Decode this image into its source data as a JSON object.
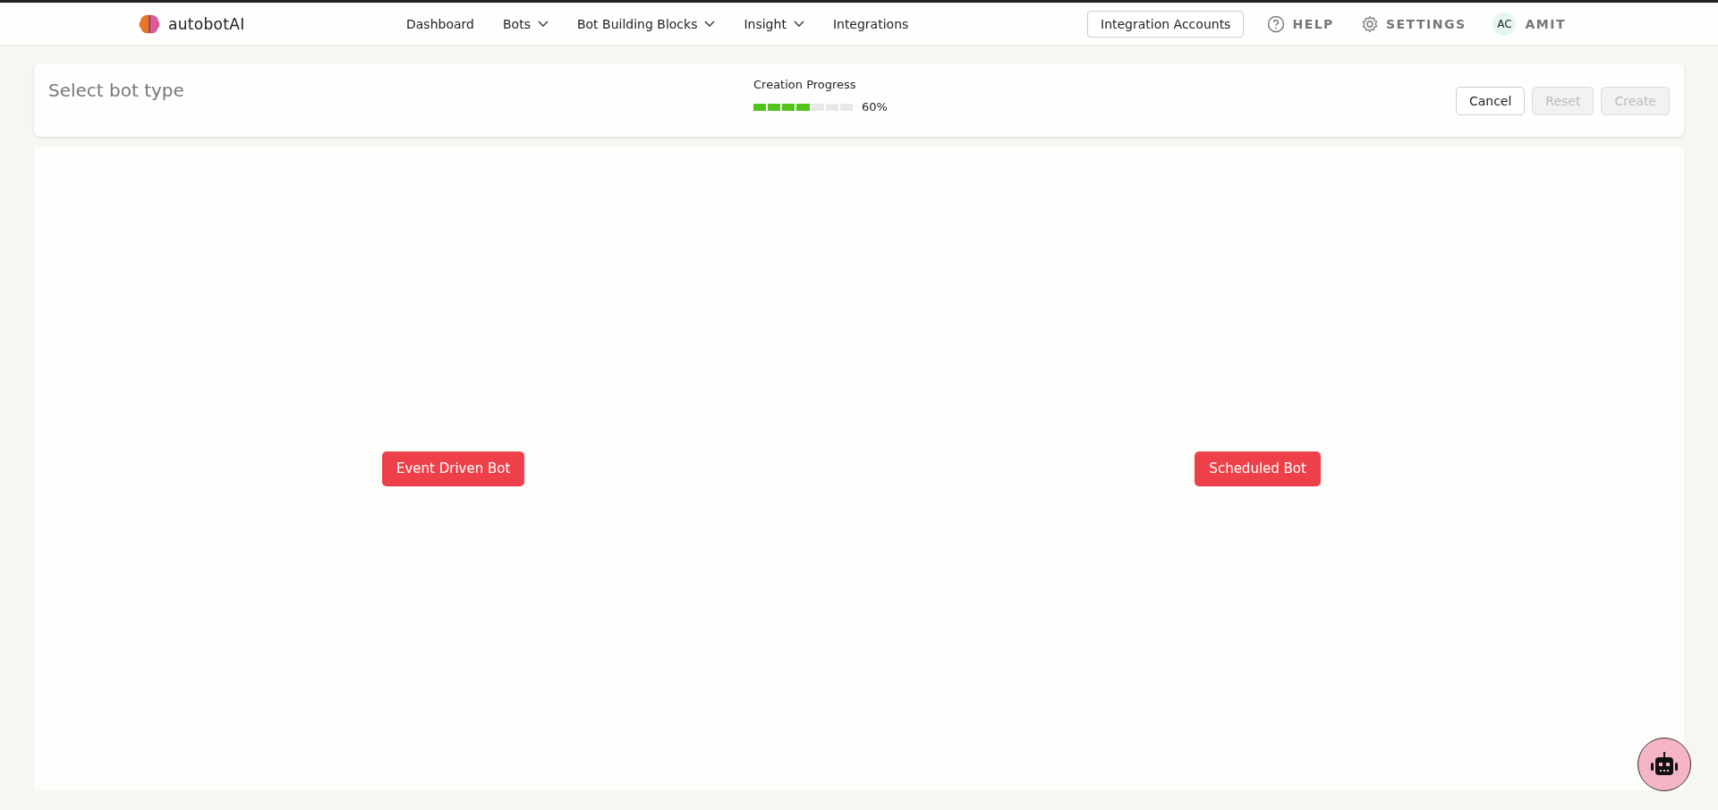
{
  "brand": {
    "name": "autobotAI"
  },
  "nav": [
    {
      "label": "Dashboard",
      "dropdown": false
    },
    {
      "label": "Bots",
      "dropdown": true
    },
    {
      "label": "Bot Building Blocks",
      "dropdown": true
    },
    {
      "label": "Insight",
      "dropdown": true
    },
    {
      "label": "Integrations",
      "dropdown": false
    }
  ],
  "integration_accounts": "Integration Accounts",
  "help": "HELP",
  "settings": "SETTINGS",
  "user": {
    "initials": "AC",
    "name": "AMIT"
  },
  "header_card": {
    "title": "Select bot type",
    "progress": {
      "label": "Creation Progress",
      "level": 0.6,
      "reading": "60%"
    },
    "buttons": [
      {
        "label": "Cancel",
        "disabled": false
      },
      {
        "label": "Reset",
        "disabled": true
      },
      {
        "label": "Create",
        "disabled": true
      }
    ]
  },
  "bot_types": [
    "Event Driven Bot",
    "Scheduled Bot"
  ]
}
